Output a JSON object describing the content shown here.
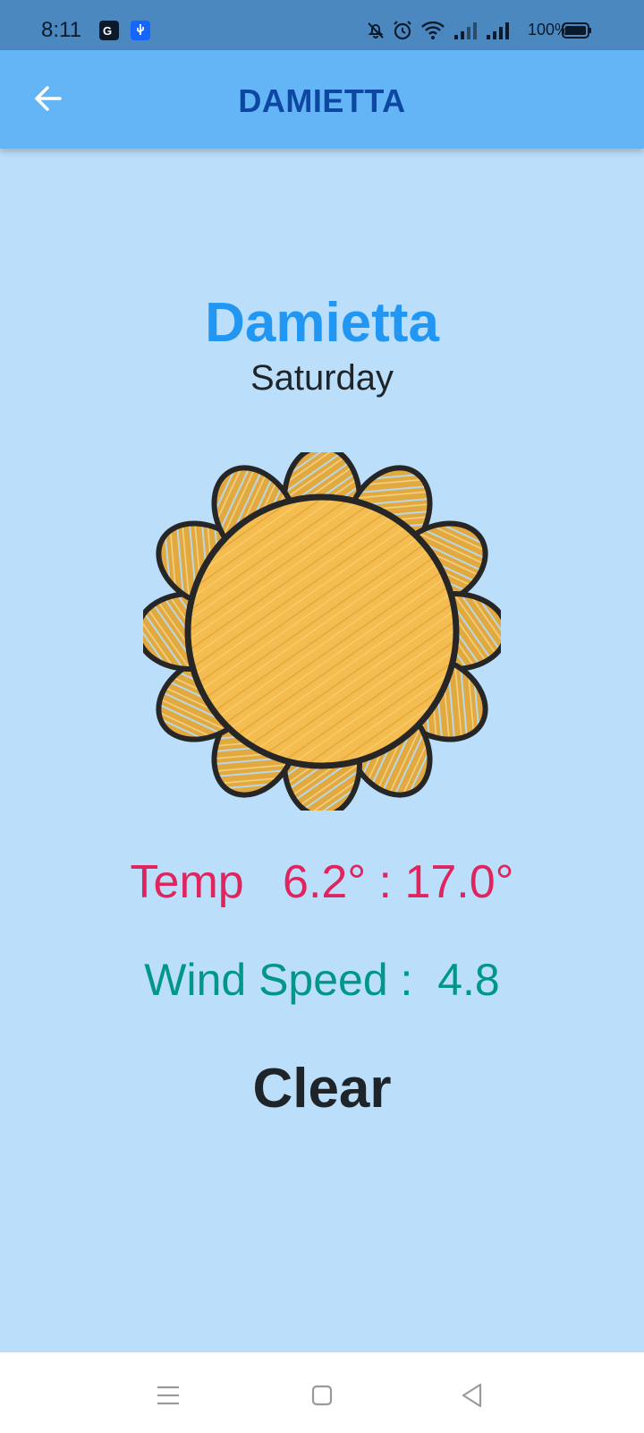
{
  "status_bar": {
    "time": "8:11",
    "battery": "100%",
    "icons": [
      "translate-icon",
      "usb-icon",
      "mute-icon",
      "alarm-icon",
      "wifi-icon",
      "signal-icon",
      "signal-icon",
      "battery-icon"
    ]
  },
  "app_bar": {
    "title": "DAMIETTA",
    "back_icon": "arrow-back-icon",
    "color": "#64b5f6",
    "title_color": "#0d47a1"
  },
  "weather": {
    "city": "Damietta",
    "day": "Saturday",
    "icon": "sun-icon",
    "temp": "Temp   6.2° : 17.0°",
    "wind": "Wind Speed :  4.8",
    "condition": "Clear",
    "colors": {
      "background": "#bbdefb",
      "city": "#2196f3",
      "temp": "#e0245e",
      "wind": "#00968a"
    }
  },
  "nav_bar": {
    "buttons": [
      "menu-icon",
      "home-icon",
      "back-triangle-icon"
    ]
  }
}
